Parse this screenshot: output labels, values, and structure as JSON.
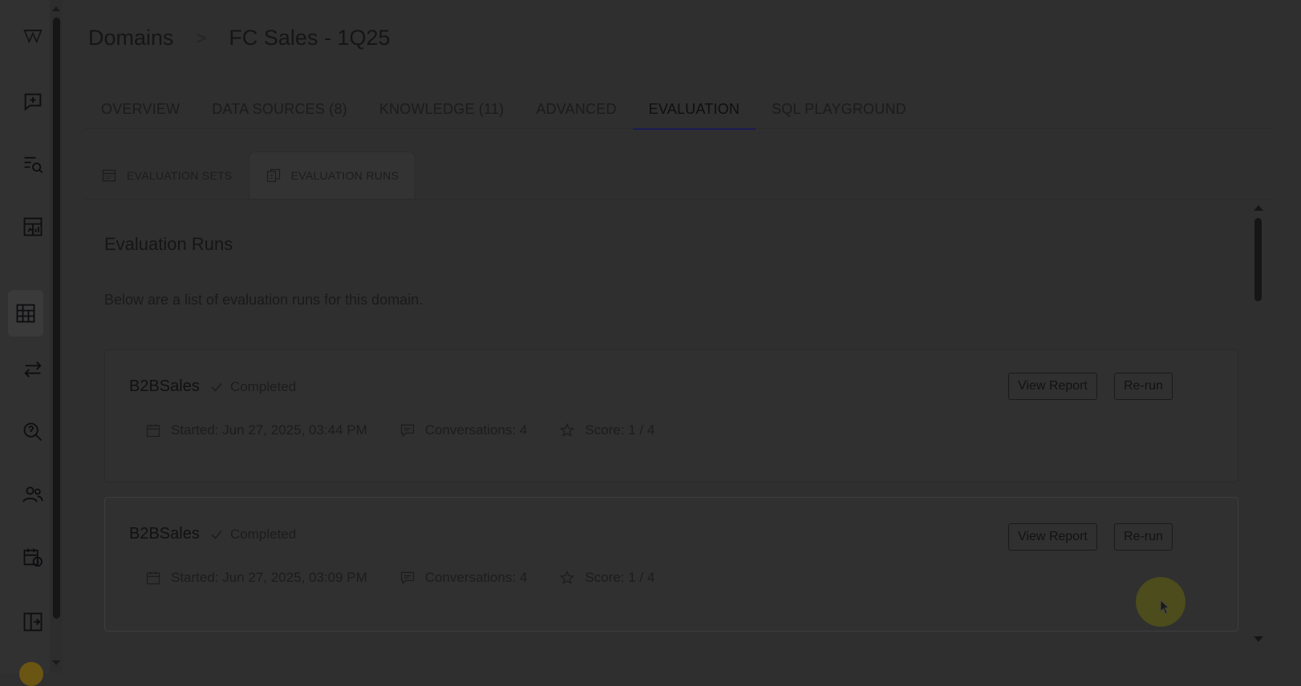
{
  "breadcrumb": {
    "root": "Domains",
    "separator": ">",
    "current": "FC Sales - 1Q25"
  },
  "tabs": [
    {
      "label": "OVERVIEW"
    },
    {
      "label": "DATA SOURCES (8)"
    },
    {
      "label": "KNOWLEDGE (11)"
    },
    {
      "label": "ADVANCED"
    },
    {
      "label": "EVALUATION",
      "active": true
    },
    {
      "label": "SQL PLAYGROUND"
    }
  ],
  "subtabs": [
    {
      "label": "EVALUATION SETS",
      "icon": "table-icon"
    },
    {
      "label": "EVALUATION RUNS",
      "icon": "copy-document-icon",
      "active": true
    }
  ],
  "section": {
    "title": "Evaluation Runs",
    "description": "Below are a list of evaluation runs for this domain."
  },
  "runs": [
    {
      "name": "B2BSales",
      "status": "Completed",
      "started": "Started: Jun 27, 2025, 03:44 PM",
      "conversations": "Conversations: 4",
      "score": "Score: 1 / 4",
      "view_label": "View Report",
      "rerun_label": "Re-run"
    },
    {
      "name": "B2BSales",
      "status": "Completed",
      "started": "Started: Jun 27, 2025, 03:09 PM",
      "conversations": "Conversations: 4",
      "score": "Score: 1 / 4",
      "view_label": "View Report",
      "rerun_label": "Re-run"
    }
  ],
  "sidebar_icons": [
    "logo-icon",
    "new-chat-icon",
    "search-list-icon",
    "dashboard-icon",
    "domains-table-icon",
    "transfer-icon",
    "query-search-icon",
    "users-icon",
    "schedule-icon",
    "collapse-icon"
  ],
  "colors": {
    "overlay_bg": "#2f2f30",
    "active_tab_underline": "#1c1c52",
    "cursor_highlight": "#4c4c1c"
  }
}
